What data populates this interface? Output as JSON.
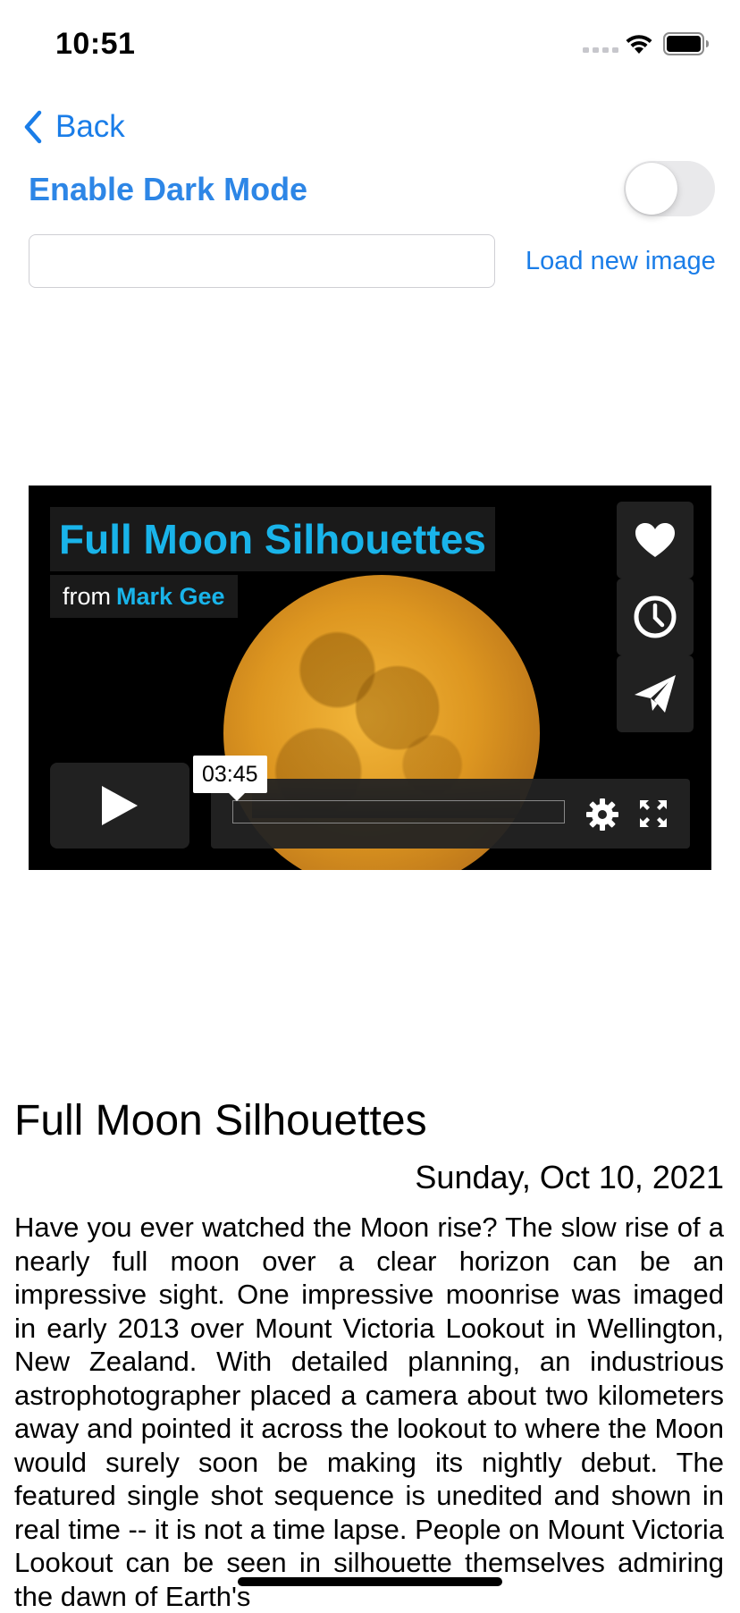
{
  "status_bar": {
    "time": "10:51"
  },
  "nav": {
    "back_label": "Back"
  },
  "settings": {
    "dark_mode_label": "Enable Dark Mode",
    "dark_mode_enabled": false
  },
  "image_loader": {
    "input_value": "",
    "input_placeholder": "",
    "load_button_label": "Load new image"
  },
  "video": {
    "title": "Full Moon Silhouettes",
    "from_label": "from",
    "author": "Mark Gee",
    "duration": "03:45",
    "side_buttons": [
      "heart-icon",
      "clock-icon",
      "paper-plane-icon"
    ],
    "accent_color": "#19b4ea"
  },
  "article": {
    "title": "Full Moon Silhouettes",
    "date": "Sunday, Oct 10, 2021",
    "body": "Have you ever watched the Moon rise? The slow rise of a nearly full moon over a clear horizon can be an impressive sight. One impressive moonrise was imaged in early 2013 over Mount Victoria Lookout in Wellington, New Zealand. With detailed planning, an industrious astrophotographer placed a camera about two kilometers away and pointed it across the lookout to where the Moon would surely soon be making its nightly debut. The featured single shot sequence is unedited and shown in real time -- it is not a time lapse. People on Mount Victoria Lookout can be seen in silhouette themselves admiring the dawn of Earth's"
  },
  "colors": {
    "link_blue": "#1a7de8",
    "toggle_off": "#e9e9eb"
  }
}
